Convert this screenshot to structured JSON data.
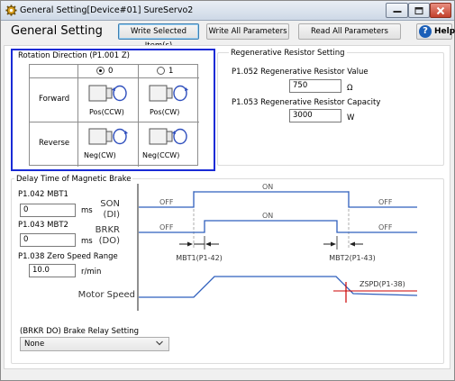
{
  "window": {
    "title": "General Setting[Device#01] SureServo2",
    "icon": "gear-icon"
  },
  "toolbar": {
    "heading": "General Setting",
    "write_selected_label": "Write Selected Item(s)",
    "write_all_label": "Write All Parameters",
    "read_all_label": "Read All Parameters",
    "help_label": "Help"
  },
  "rotation": {
    "title": "Rotation Direction (P1.001 Z)",
    "options": [
      "0",
      "1"
    ],
    "selected": "0",
    "rows": [
      {
        "label": "Forward",
        "col0": "Pos(CCW)",
        "col1": "Pos(CW)"
      },
      {
        "label": "Reverse",
        "col0": "Neg(CW)",
        "col1": "Neg(CCW)"
      }
    ]
  },
  "regen": {
    "title": "Regenerative Resistor Setting",
    "value_label": "P1.052 Regenerative Resistor Value",
    "value": "750",
    "value_unit": "Ω",
    "capacity_label": "P1.053 Regenerative Resistor Capacity",
    "capacity": "3000",
    "capacity_unit": "W"
  },
  "brake": {
    "title": "Delay Time of Magnetic Brake",
    "mbt1_label": "P1.042 MBT1",
    "mbt1_value": "0",
    "mbt1_unit": "ms",
    "mbt2_label": "P1.043 MBT2",
    "mbt2_value": "0",
    "mbt2_unit": "ms",
    "zero_speed_label": "P1.038 Zero Speed Range",
    "zero_speed_value": "10.0",
    "zero_speed_unit": "r/min",
    "relay_label": "(BRKR DO) Brake Relay Setting",
    "relay_value": "None"
  },
  "timing": {
    "son_label_1": "SON",
    "son_label_2": "(DI)",
    "brkr_label_1": "BRKR",
    "brkr_label_2": "(DO)",
    "motor_speed_label": "Motor Speed",
    "off": "OFF",
    "on": "ON",
    "mbt1_marker": "MBT1(P1-42)",
    "mbt2_marker": "MBT2(P1-43)",
    "zspd_label": "ZSPD(P1-38)"
  },
  "colors": {
    "accent_blue": "#1a2bd6",
    "signal_blue": "#2f5fbd",
    "zspd_red": "#cc0000"
  }
}
